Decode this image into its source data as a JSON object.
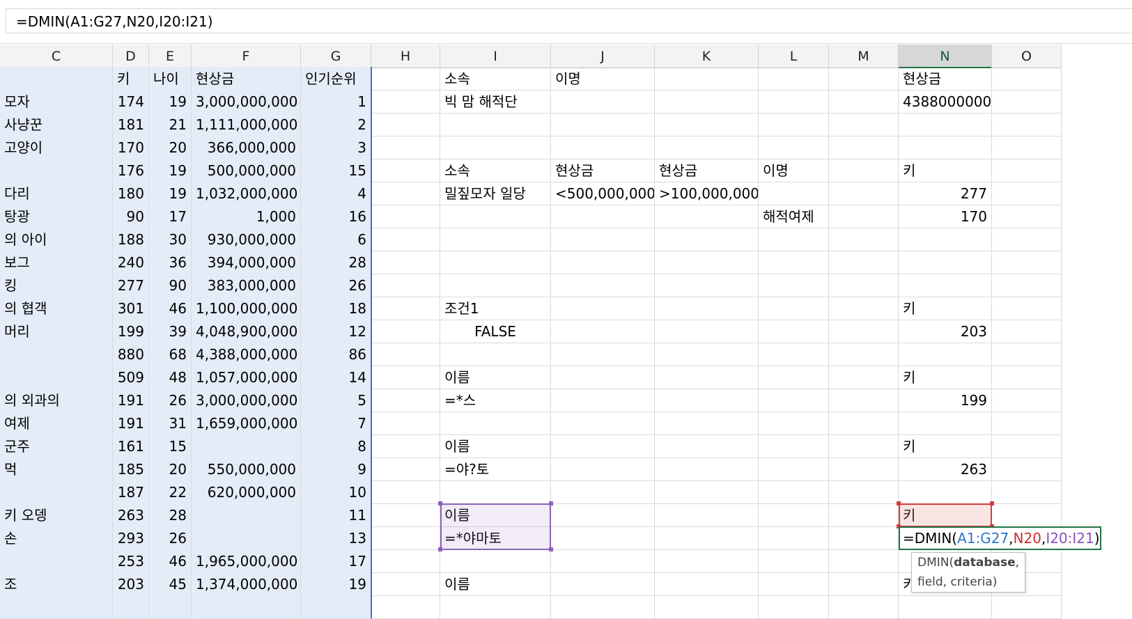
{
  "formula_bar": {
    "formula": "=DMIN(A1:G27,N20,I20:I21)"
  },
  "columns": [
    "C",
    "D",
    "E",
    "F",
    "G",
    "H",
    "I",
    "J",
    "K",
    "L",
    "M",
    "N",
    "O"
  ],
  "active_column": "N",
  "left_table": {
    "header": {
      "D": "키",
      "E": "나이",
      "F": "현상금",
      "G": "인기순위"
    },
    "rows": [
      {
        "C": "모자",
        "D": "174",
        "E": "19",
        "F": "3,000,000,000",
        "G": "1"
      },
      {
        "C": "사냥꾼",
        "D": "181",
        "E": "21",
        "F": "1,111,000,000",
        "G": "2"
      },
      {
        "C": "고양이",
        "D": "170",
        "E": "20",
        "F": "366,000,000",
        "G": "3"
      },
      {
        "C": "",
        "D": "176",
        "E": "19",
        "F": "500,000,000",
        "G": "15"
      },
      {
        "C": "다리",
        "D": "180",
        "E": "19",
        "F": "1,032,000,000",
        "G": "4"
      },
      {
        "C": "탕광",
        "D": "90",
        "E": "17",
        "F": "1,000",
        "G": "16"
      },
      {
        "C": "의 아이",
        "D": "188",
        "E": "30",
        "F": "930,000,000",
        "G": "6"
      },
      {
        "C": "보그",
        "D": "240",
        "E": "36",
        "F": "394,000,000",
        "G": "28"
      },
      {
        "C": "킹",
        "D": "277",
        "E": "90",
        "F": "383,000,000",
        "G": "26"
      },
      {
        "C": "의 협객",
        "D": "301",
        "E": "46",
        "F": "1,100,000,000",
        "G": "18"
      },
      {
        "C": "머리",
        "D": "199",
        "E": "39",
        "F": "4,048,900,000",
        "G": "12"
      },
      {
        "C": "",
        "D": "880",
        "E": "68",
        "F": "4,388,000,000",
        "G": "86"
      },
      {
        "C": "",
        "D": "509",
        "E": "48",
        "F": "1,057,000,000",
        "G": "14"
      },
      {
        "C": "의 외과의",
        "D": "191",
        "E": "26",
        "F": "3,000,000,000",
        "G": "5"
      },
      {
        "C": "여제",
        "D": "191",
        "E": "31",
        "F": "1,659,000,000",
        "G": "7"
      },
      {
        "C": "군주",
        "D": "161",
        "E": "15",
        "F": "",
        "G": "8"
      },
      {
        "C": "먹",
        "D": "185",
        "E": "20",
        "F": "550,000,000",
        "G": "9"
      },
      {
        "C": "",
        "D": "187",
        "E": "22",
        "F": "620,000,000",
        "G": "10"
      },
      {
        "C": "키 오뎅",
        "D": "263",
        "E": "28",
        "F": "",
        "G": "11"
      },
      {
        "C": "손",
        "D": "293",
        "E": "26",
        "F": "",
        "G": "13"
      },
      {
        "C": "",
        "D": "253",
        "E": "46",
        "F": "1,965,000,000",
        "G": "17"
      },
      {
        "C": "조",
        "D": "203",
        "E": "45",
        "F": "1,374,000,000",
        "G": "19"
      }
    ]
  },
  "criteria": {
    "r1": {
      "I": "소속",
      "J": "이명",
      "N": "현상금"
    },
    "r2": {
      "I": "빅 맘 해적단",
      "N": "4388000000"
    },
    "r5": {
      "I": "소속",
      "J": "현상금",
      "K": "현상금",
      "L": "이명",
      "N": "키"
    },
    "r6": {
      "I": "밀짚모자 일당",
      "J": "<500,000,000",
      "K": ">100,000,000",
      "N": "277"
    },
    "r7": {
      "L": "해적여제",
      "N": "170"
    },
    "r11": {
      "I": "조건1",
      "N": "키"
    },
    "r12": {
      "I": "FALSE",
      "N": "203"
    },
    "r14": {
      "I": "이름",
      "N": "키"
    },
    "r15": {
      "I": "=*스",
      "N": "199"
    },
    "r17": {
      "I": "이름",
      "N": "키"
    },
    "r18": {
      "I": "=야?토",
      "N": "263"
    },
    "r20": {
      "I": "이름",
      "N": "키"
    },
    "r21": {
      "I": "=*야마토"
    },
    "r23": {
      "I": "이름",
      "N": "키"
    }
  },
  "editing_cell": {
    "prefix": "=DMIN(",
    "arg1": "A1:G27",
    "sep1": ",",
    "arg2": "N20",
    "sep2": ",",
    "arg3": "I20:I21",
    "suffix": ")"
  },
  "tooltip": {
    "func": "DMIN(",
    "bold_arg": "database",
    "rest": ", field, criteria)"
  },
  "colors": {
    "accent_green": "#217346",
    "range_purple": "#8e62b6",
    "range_red": "#d43c3c",
    "range_blue": "#2e75c9",
    "selection_bg": "#e4ecf7"
  }
}
